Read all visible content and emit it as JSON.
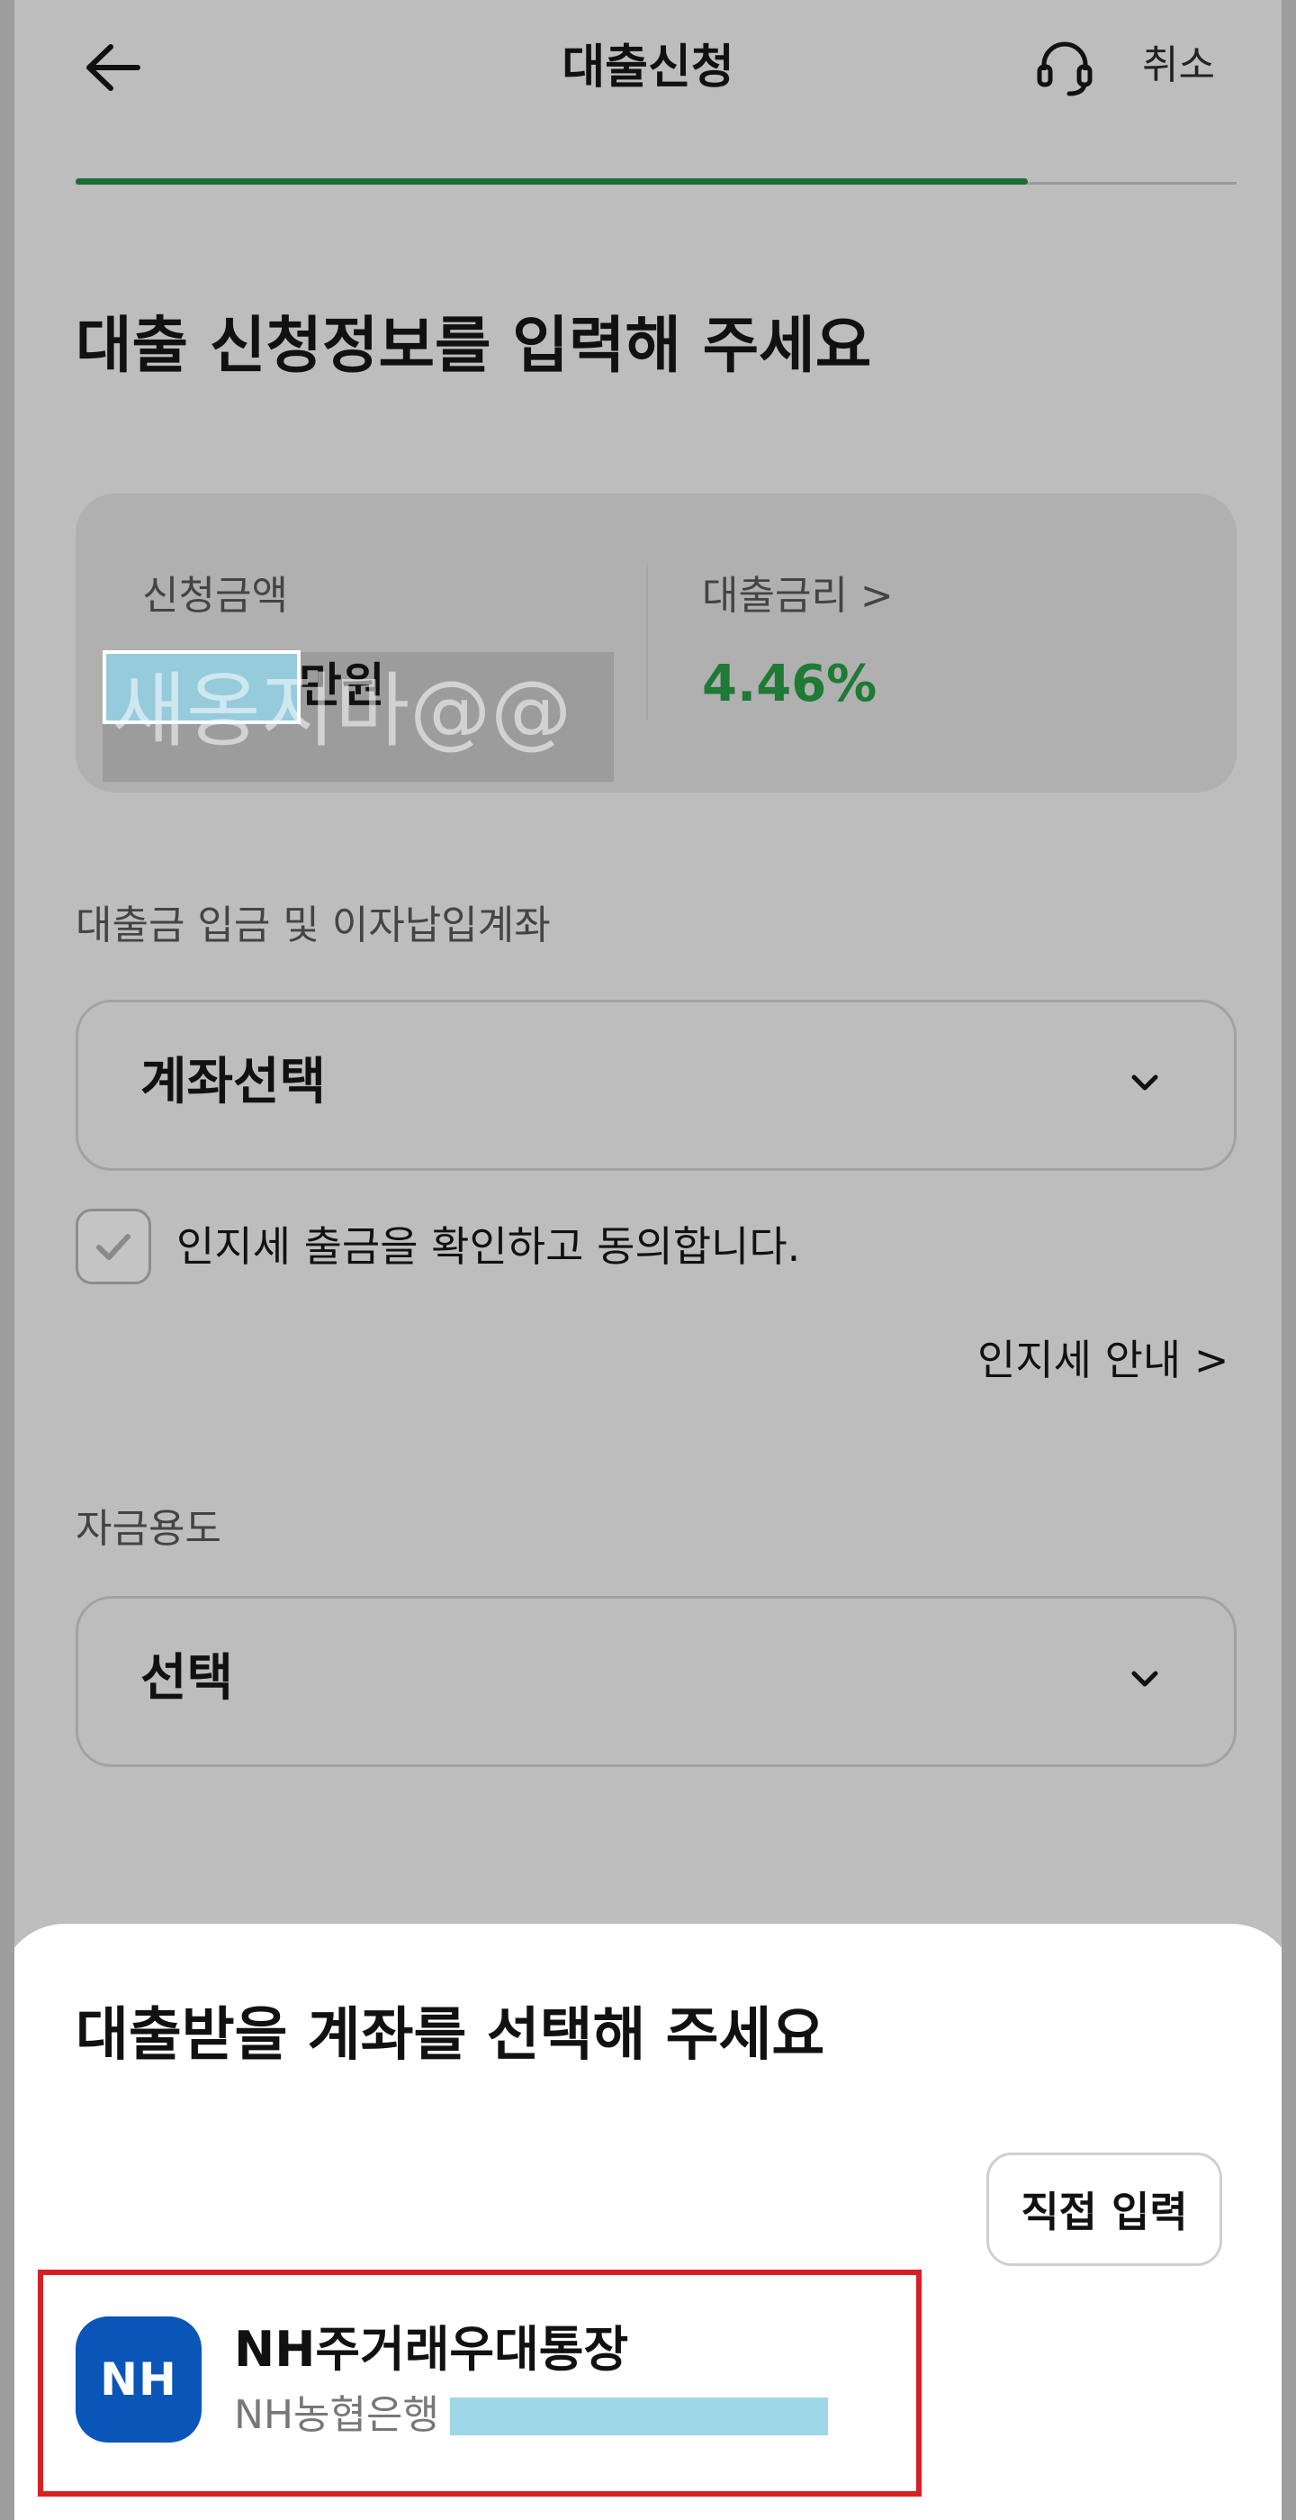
{
  "header": {
    "title": "대출신청",
    "cancel_label": "취소",
    "progress": 0.82
  },
  "main": {
    "heading": "대출 신청정보를 입력해 주세요",
    "summary": {
      "amount_label": "신청금액",
      "amount_unit": "만원",
      "rate_label": "대출금리 >",
      "rate_value": "4.46%"
    },
    "watermark": "새옹지마@@",
    "account_section": {
      "label": "대출금 입금 및 이자납입계좌",
      "value": "계좌선택"
    },
    "stamp_tax": {
      "checkbox_label": "인지세 출금을 확인하고 동의합니다.",
      "checked": true,
      "info_link": "인지세 안내 >"
    },
    "purpose_section": {
      "label": "자금용도",
      "value": "선택"
    }
  },
  "sheet": {
    "title": "대출받을 계좌를 선택해 주세요",
    "direct_input_label": "직접 입력",
    "accounts": [
      {
        "logo_text": "NH",
        "name": "NH주거래우대통장",
        "bank": "NH농협은행"
      }
    ]
  },
  "colors": {
    "accent_green": "#1e7a34",
    "highlight_red": "#d81f26",
    "bank_blue": "#0a55b8"
  },
  "icons": [
    "back-arrow-icon",
    "headset-icon",
    "chevron-down-icon",
    "checkmark-icon"
  ]
}
